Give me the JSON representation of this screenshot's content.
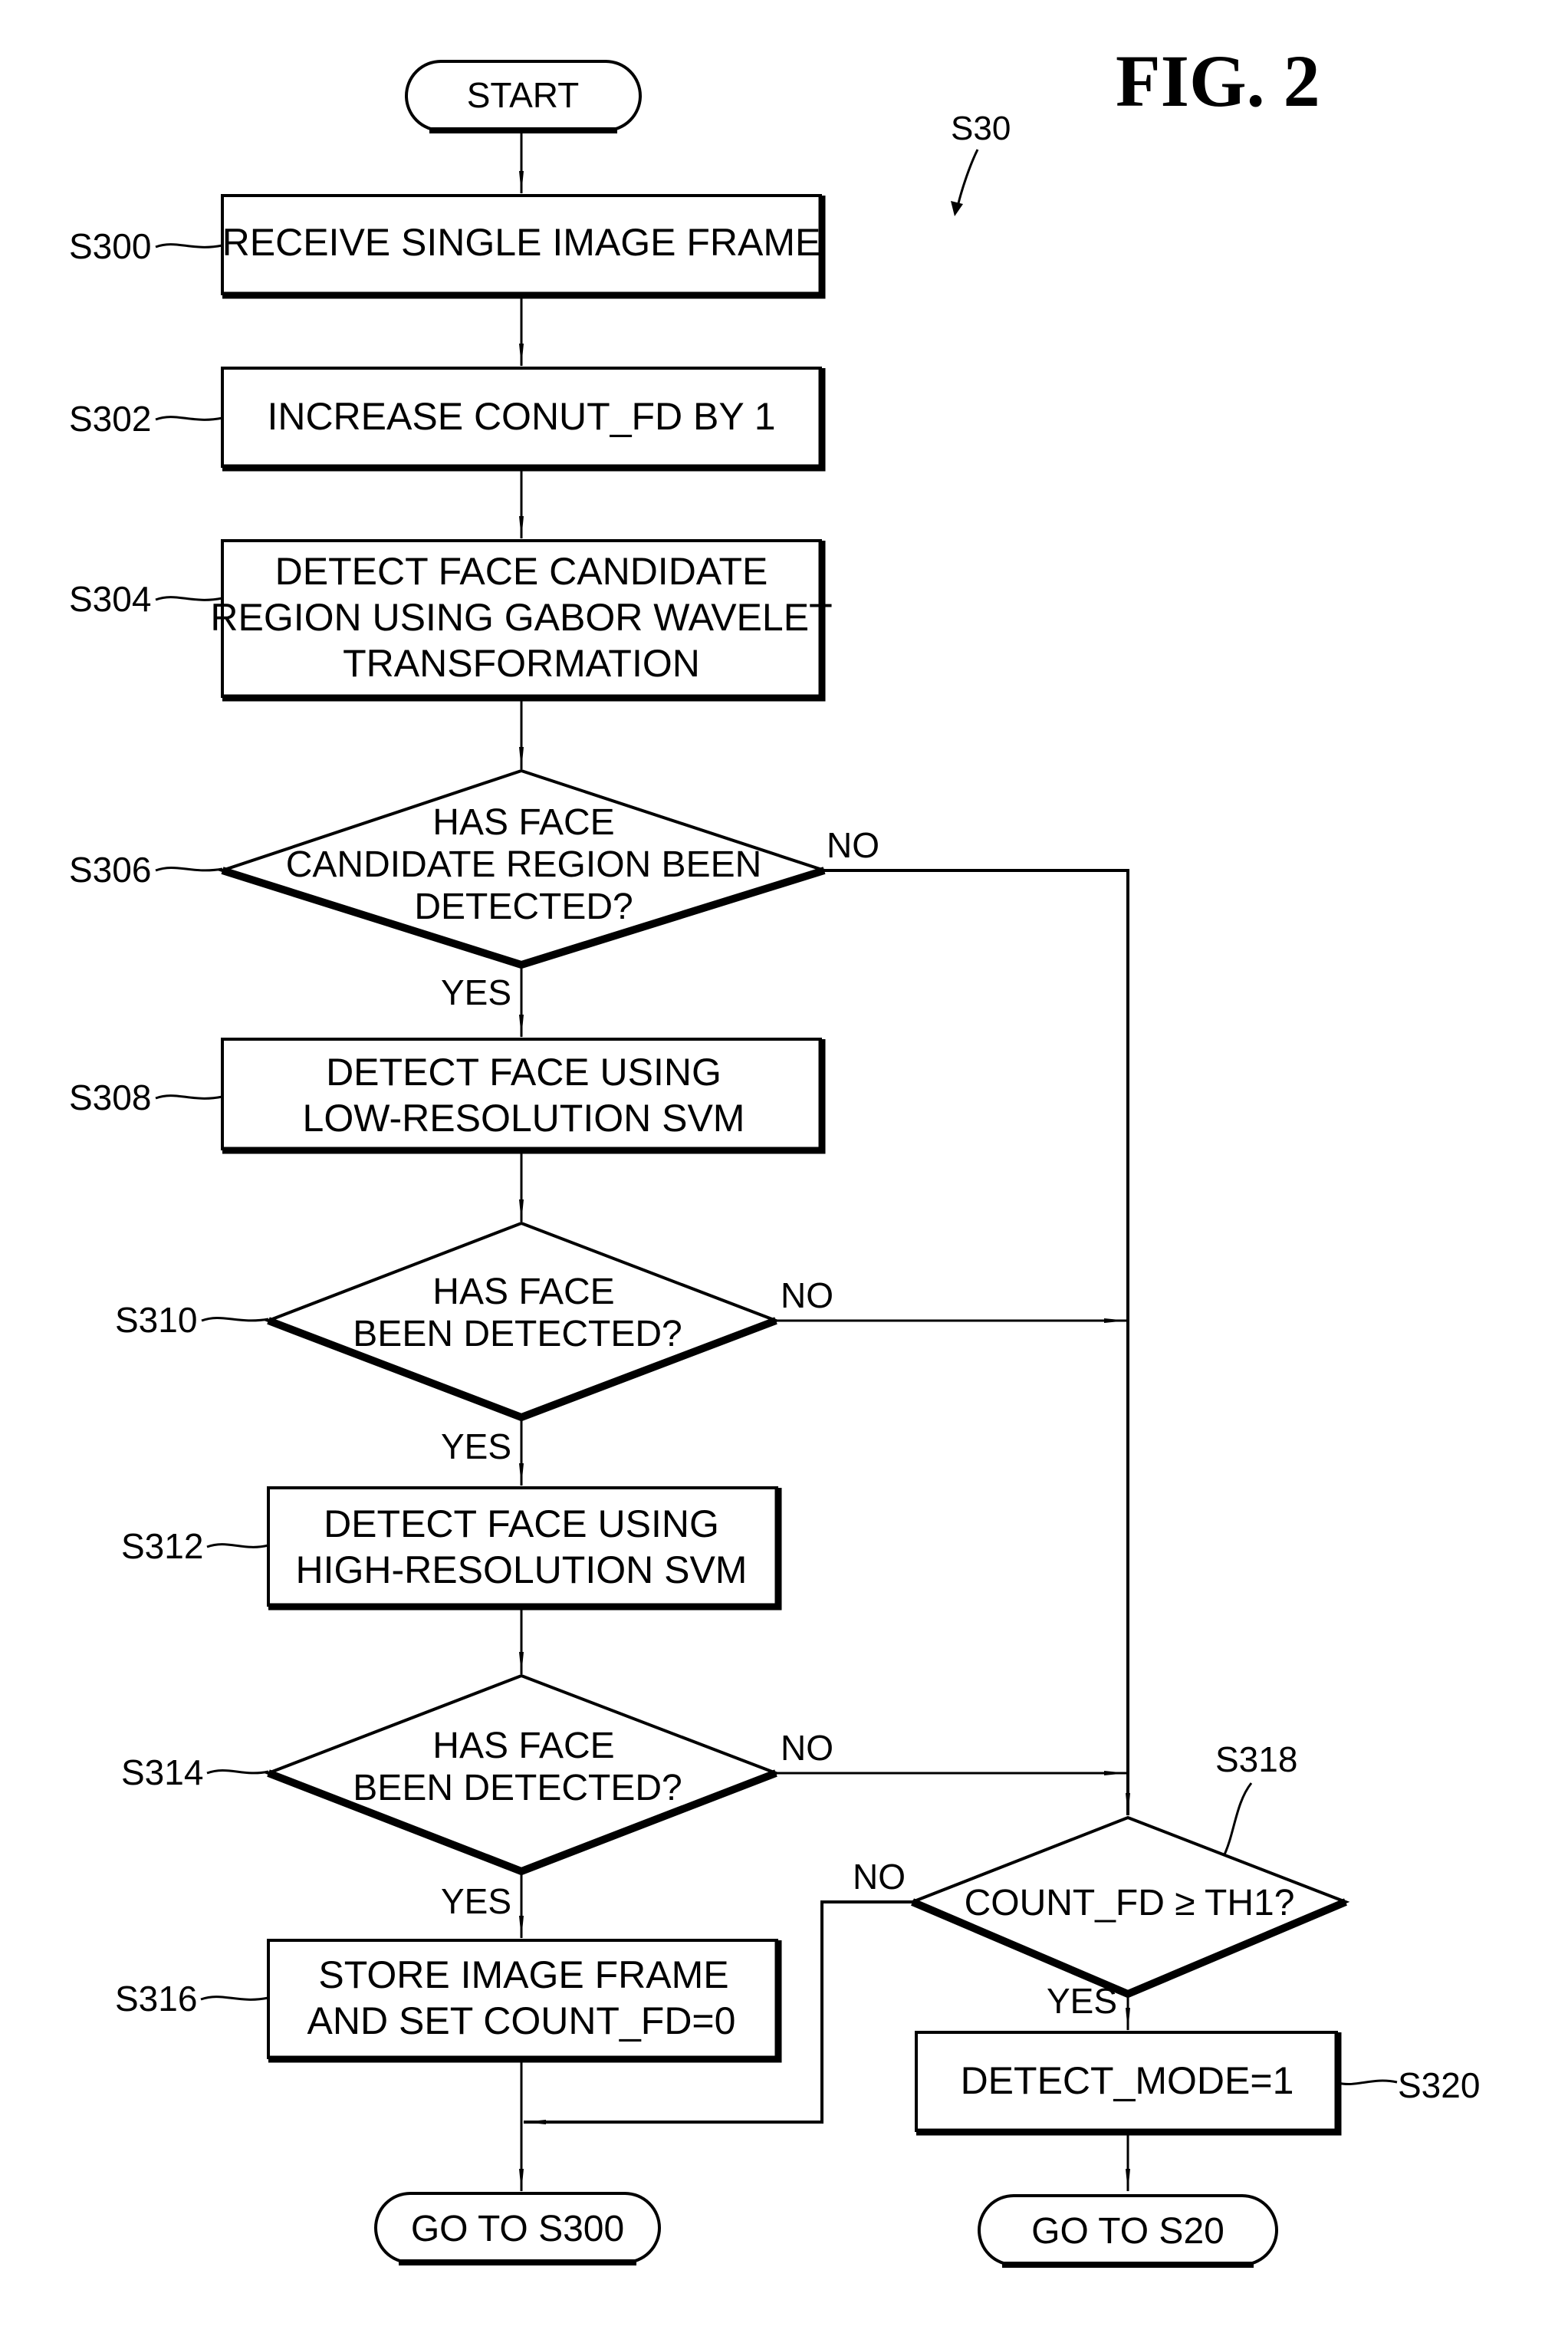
{
  "figure": {
    "title": "FIG. 2",
    "reference": "S30"
  },
  "colors": {
    "ink": "#000000",
    "paper": "#ffffff"
  },
  "nodes": {
    "start": {
      "type": "terminal",
      "label": "START"
    },
    "s300": {
      "type": "process",
      "step": "S300",
      "lines": [
        "RECEIVE SINGLE IMAGE FRAME"
      ]
    },
    "s302": {
      "type": "process",
      "step": "S302",
      "lines": [
        "INCREASE CONUT_FD BY 1"
      ]
    },
    "s304": {
      "type": "process",
      "step": "S304",
      "lines": [
        "DETECT FACE CANDIDATE",
        "REGION USING GABOR WAVELET",
        "TRANSFORMATION"
      ]
    },
    "s306": {
      "type": "decision",
      "step": "S306",
      "lines": [
        "HAS FACE",
        "CANDIDATE REGION BEEN",
        "DETECTED?"
      ],
      "yes": "YES",
      "no": "NO"
    },
    "s308": {
      "type": "process",
      "step": "S308",
      "lines": [
        "DETECT FACE USING",
        "LOW-RESOLUTION SVM"
      ]
    },
    "s310": {
      "type": "decision",
      "step": "S310",
      "lines": [
        "HAS FACE",
        "BEEN DETECTED?"
      ],
      "yes": "YES",
      "no": "NO"
    },
    "s312": {
      "type": "process",
      "step": "S312",
      "lines": [
        "DETECT FACE USING",
        "HIGH-RESOLUTION SVM"
      ]
    },
    "s314": {
      "type": "decision",
      "step": "S314",
      "lines": [
        "HAS FACE",
        "BEEN DETECTED?"
      ],
      "yes": "YES",
      "no": "NO"
    },
    "s316": {
      "type": "process",
      "step": "S316",
      "lines": [
        "STORE IMAGE FRAME",
        "AND SET COUNT_FD=0"
      ]
    },
    "s318": {
      "type": "decision",
      "step": "S318",
      "lines": [
        "COUNT_FD ≥ TH1?"
      ],
      "yes": "YES",
      "no": "NO"
    },
    "s320": {
      "type": "process",
      "step": "S320",
      "lines": [
        "DETECT_MODE=1"
      ]
    },
    "goto_s300": {
      "type": "terminal",
      "label": "GO TO S300"
    },
    "goto_s20": {
      "type": "terminal",
      "label": "GO TO S20"
    }
  },
  "edges": [
    {
      "from": "start",
      "to": "s300"
    },
    {
      "from": "s300",
      "to": "s302"
    },
    {
      "from": "s302",
      "to": "s304"
    },
    {
      "from": "s304",
      "to": "s306"
    },
    {
      "from": "s306",
      "to": "s308",
      "label": "YES"
    },
    {
      "from": "s306",
      "to": "s318",
      "label": "NO"
    },
    {
      "from": "s308",
      "to": "s310"
    },
    {
      "from": "s310",
      "to": "s312",
      "label": "YES"
    },
    {
      "from": "s310",
      "to": "s318",
      "label": "NO"
    },
    {
      "from": "s312",
      "to": "s314"
    },
    {
      "from": "s314",
      "to": "s316",
      "label": "YES"
    },
    {
      "from": "s314",
      "to": "s318",
      "label": "NO"
    },
    {
      "from": "s316",
      "to": "goto_s300"
    },
    {
      "from": "s318",
      "to": "s320",
      "label": "YES"
    },
    {
      "from": "s318",
      "to": "goto_s300",
      "label": "NO"
    },
    {
      "from": "s320",
      "to": "goto_s20"
    }
  ]
}
